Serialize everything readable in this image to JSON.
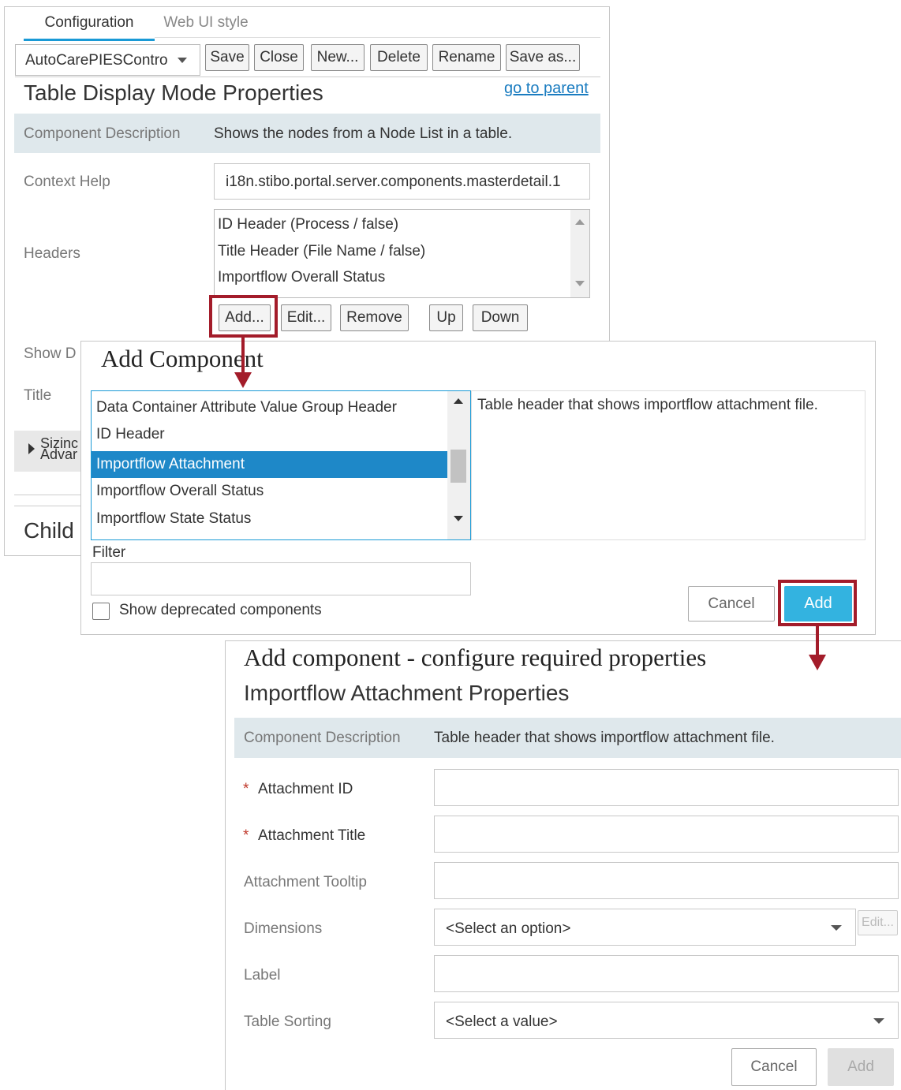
{
  "panel1": {
    "tabs": [
      "Configuration",
      "Web UI style"
    ],
    "selector_value": "AutoCarePIESContro",
    "toolbar": [
      "Save",
      "Close",
      "New...",
      "Delete",
      "Rename",
      "Save as..."
    ],
    "title": "Table Display Mode Properties",
    "go_to_parent": "go to parent",
    "component_description_label": "Component Description",
    "component_description_value": "Shows the nodes from a Node List in a table.",
    "context_help_label": "Context Help",
    "context_help_value": "i18n.stibo.portal.server.components.masterdetail.1",
    "headers_label": "Headers",
    "headers_items": [
      "ID Header (Process / false)",
      "Title Header (File Name / false)",
      "Importflow Overall Status"
    ],
    "header_buttons": [
      "Add...",
      "Edit...",
      "Remove",
      "Up",
      "Down"
    ],
    "show_label": "Show D",
    "title_label": "Title",
    "sizing_label": "Sizinc",
    "advanced_label": "Advar",
    "child_label": "Child"
  },
  "dialog": {
    "title": "Add Component",
    "items": [
      "Data Container Attribute Value Group Header",
      "ID Header",
      "Importflow Attachment",
      "Importflow Overall Status",
      "Importflow State Status"
    ],
    "selected_index": 2,
    "description": "Table header that shows importflow attachment file.",
    "filter_label": "Filter",
    "filter_value": "",
    "deprecated_label": "Show deprecated components",
    "cancel_label": "Cancel",
    "add_label": "Add"
  },
  "panel3": {
    "title": "Add component - configure required properties",
    "subtitle": "Importflow Attachment Properties",
    "component_description_label": "Component Description",
    "component_description_value": "Table header that shows importflow attachment file.",
    "required_mark": "*",
    "fields": {
      "attachment_id": "Attachment ID",
      "attachment_title": "Attachment Title",
      "attachment_tooltip": "Attachment Tooltip",
      "dimensions": "Dimensions",
      "label": "Label",
      "table_sorting": "Table Sorting"
    },
    "dimensions_value": "<Select an option>",
    "dimensions_edit": "Edit...",
    "table_sorting_value": "<Select a value>",
    "cancel_label": "Cancel",
    "add_label": "Add"
  },
  "colors": {
    "accent": "#1a9ad6",
    "selected_bg": "#1e88c8",
    "add_button": "#33b3e0",
    "highlight_red": "#a31c2a",
    "desc_bg": "#dfe8ec"
  }
}
